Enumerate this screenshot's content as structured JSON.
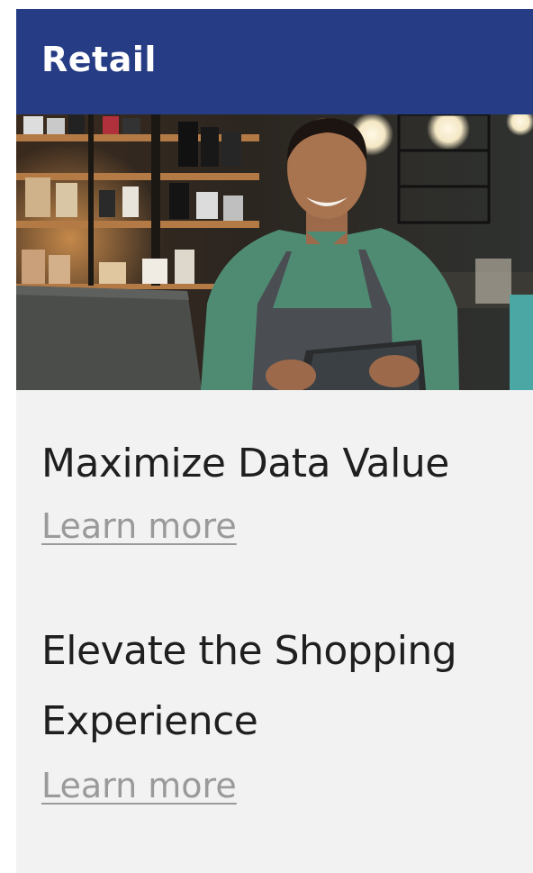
{
  "header": {
    "title": "Retail"
  },
  "hero": {
    "image_name": "shopkeeper-with-tablet-image"
  },
  "items": [
    {
      "title": "Maximize Data Value",
      "link": "Learn more"
    },
    {
      "title": "Elevate the Shopping Experience",
      "link": "Learn more"
    }
  ],
  "colors": {
    "header_bg": "#263c85",
    "card_bg": "#f2f2f2",
    "link": "#9a9a9a",
    "text": "#1f1f1f"
  }
}
